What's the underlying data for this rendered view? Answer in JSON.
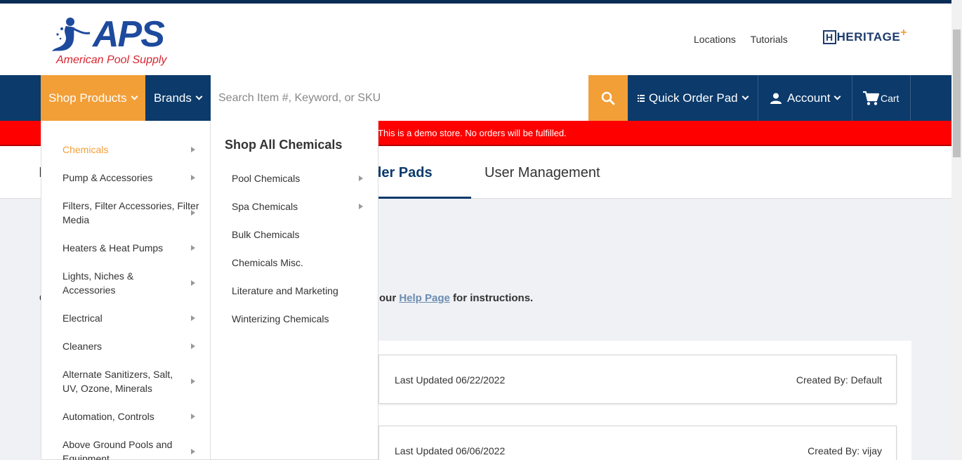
{
  "header": {
    "logo_text": "APS",
    "logo_subtitle": "American Pool Supply",
    "links": [
      "Locations",
      "Tutorials"
    ],
    "partner_logo": "HERITAGE"
  },
  "nav": {
    "shop_products": "Shop Products",
    "brands": "Brands",
    "search_placeholder": "Search Item #, Keyword, or SKU",
    "quick_order_pad": "Quick Order Pad",
    "account": "Account",
    "cart": "Cart"
  },
  "demo_banner": "This is a demo store. No orders will be fulfilled.",
  "tabs": {
    "active": "eorder Pads",
    "user_management": "User Management",
    "partial_left": "I"
  },
  "help": {
    "partial_left": "C",
    "prefix": "our ",
    "link": "Help Page",
    "suffix": " for instructions."
  },
  "cards": [
    {
      "updated": "Last Updated 06/22/2022",
      "created_by": "Created By: Default"
    },
    {
      "updated": "Last Updated 06/06/2022",
      "created_by": "Created By: vijay"
    }
  ],
  "shop_menu": {
    "categories": [
      {
        "label": "Chemicals",
        "active": true
      },
      {
        "label": "Pump & Accessories"
      },
      {
        "label": "Filters, Filter Accessories, Filter Media"
      },
      {
        "label": "Heaters & Heat Pumps"
      },
      {
        "label": "Lights, Niches & Accessories"
      },
      {
        "label": "Electrical"
      },
      {
        "label": "Cleaners"
      },
      {
        "label": "Alternate Sanitizers, Salt, UV, Ozone, Minerals"
      },
      {
        "label": "Automation, Controls"
      },
      {
        "label": "Above Ground Pools and Equipment"
      }
    ],
    "submenu_title": "Shop All Chemicals",
    "subcategories": [
      {
        "label": "Pool Chemicals",
        "has_children": true
      },
      {
        "label": "Spa Chemicals",
        "has_children": true
      },
      {
        "label": "Bulk Chemicals"
      },
      {
        "label": "Chemicals Misc."
      },
      {
        "label": "Literature and Marketing"
      },
      {
        "label": "Winterizing Chemicals"
      }
    ]
  },
  "colors": {
    "navy": "#0b3a6b",
    "orange": "#f29f38",
    "demo_red": "#ff0000"
  }
}
